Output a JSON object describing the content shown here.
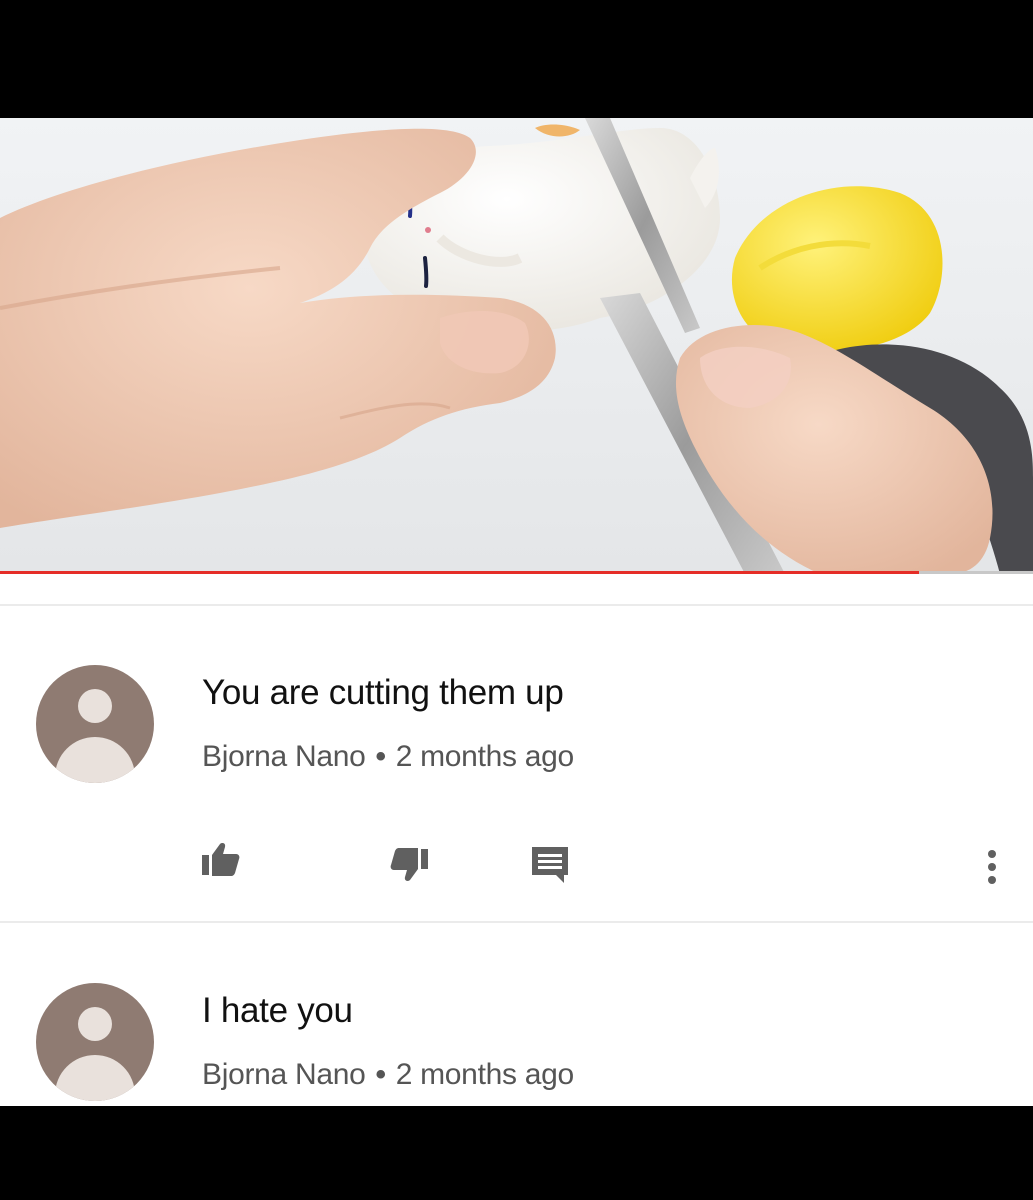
{
  "video": {
    "progress_percent": 89
  },
  "comments": [
    {
      "text": "You are cutting them up",
      "author": "Bjorna Nano",
      "separator": "•",
      "time": "2 months ago"
    },
    {
      "text": "I hate you",
      "author": "Bjorna Nano",
      "separator": "•",
      "time": "2 months ago"
    }
  ],
  "actions": {
    "like_icon": "thumbs-up-icon",
    "dislike_icon": "thumbs-down-icon",
    "reply_icon": "reply-comment-icon",
    "more_icon": "more-vertical-icon"
  },
  "colors": {
    "progress": "#e52d27",
    "avatar_bg": "#8f7b72",
    "icon": "#606060"
  }
}
